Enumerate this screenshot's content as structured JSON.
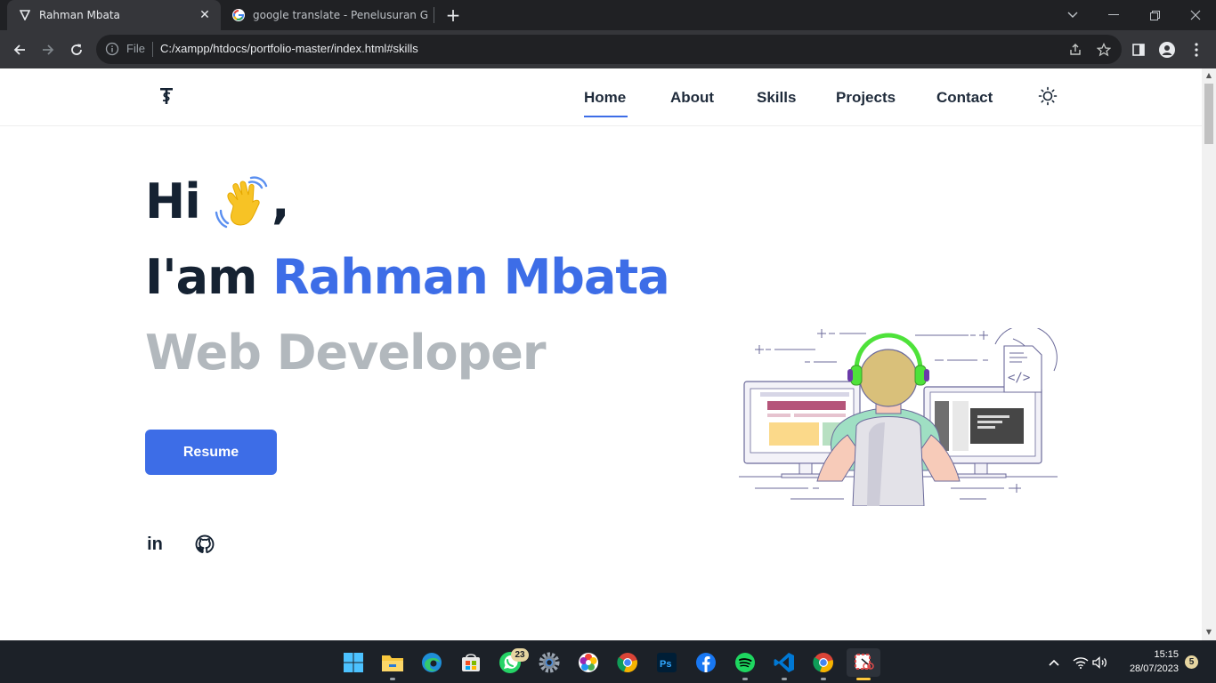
{
  "browser": {
    "tabs": [
      {
        "title": "Rahman Mbata",
        "active": true
      },
      {
        "title": "google translate - Penelusuran G",
        "active": false
      }
    ],
    "omnibox": {
      "scheme_label": "File",
      "url": "C:/xampp/htdocs/portfolio-master/index.html#skills"
    }
  },
  "site": {
    "nav": [
      "Home",
      "About",
      "Skills",
      "Projects",
      "Contact"
    ],
    "active_nav": "Home",
    "hero": {
      "greeting": "Hi",
      "comma": ",",
      "intro_prefix": "I'am",
      "name": "Rahman Mbata",
      "role": "Web Developer",
      "button": "Resume"
    },
    "social": {
      "linkedin_glyph": "in"
    },
    "colors": {
      "accent": "#3d6de7",
      "heading": "#152232",
      "role": "#b2b8bd"
    }
  },
  "taskbar": {
    "whatsapp_badge": "23",
    "time": "15:15",
    "date": "28/07/2023",
    "notification_count": "5",
    "icons": [
      "start-icon",
      "file-explorer-icon",
      "edge-icon",
      "store-icon",
      "whatsapp-icon",
      "settings-icon",
      "color-app-icon",
      "chrome-icon",
      "photoshop-icon",
      "facebook-icon",
      "spotify-icon",
      "vscode-icon",
      "chrome-icon",
      "snipping-tool-icon"
    ]
  }
}
